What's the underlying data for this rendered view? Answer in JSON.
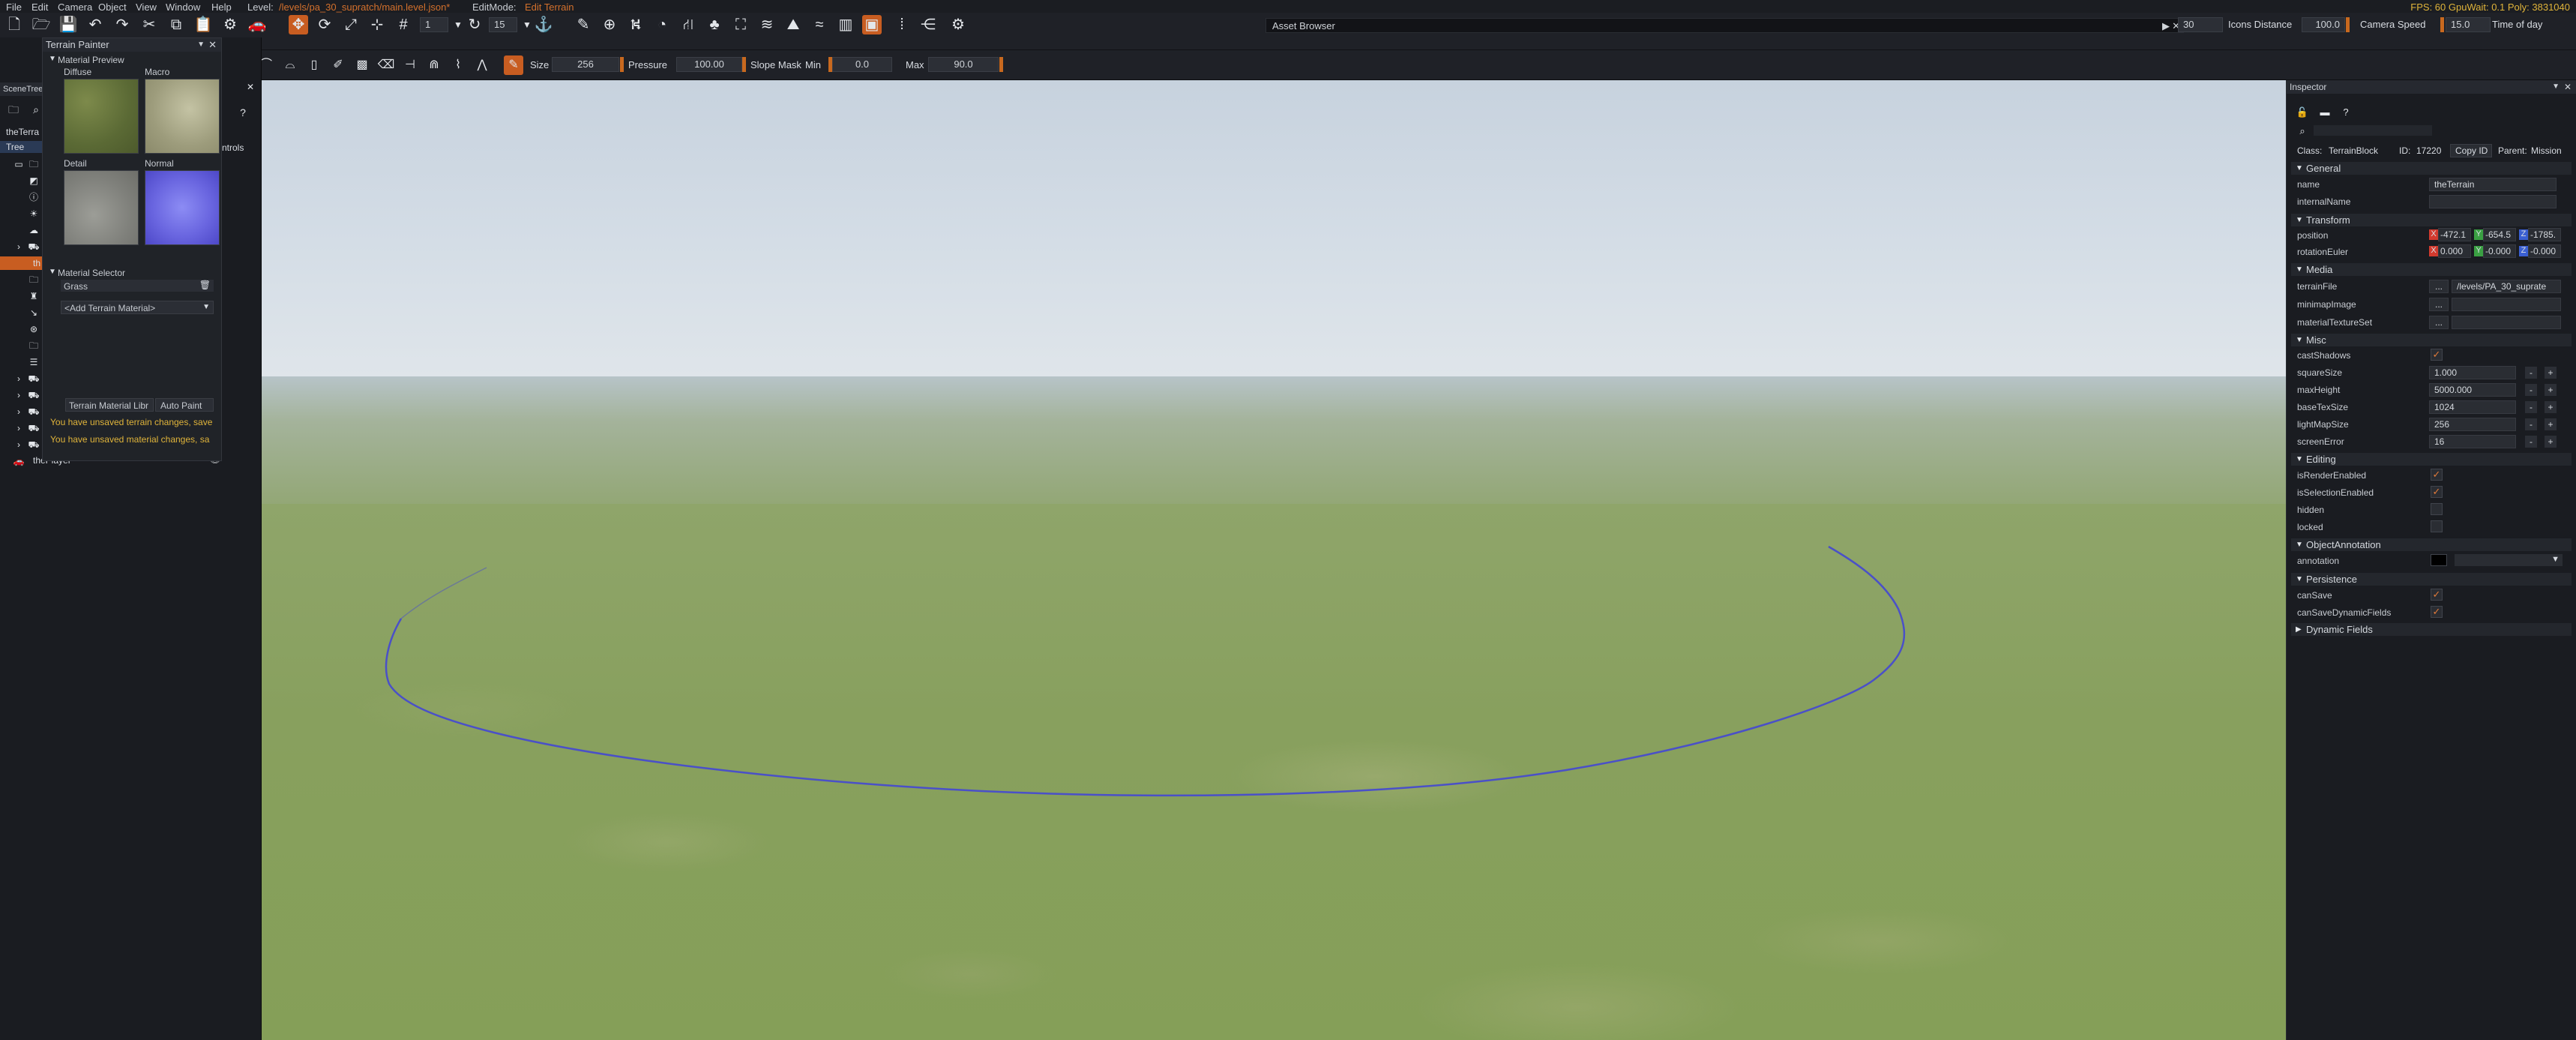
{
  "menu": {
    "items": [
      "File",
      "Edit",
      "Camera",
      "Object",
      "View",
      "Window",
      "Help"
    ],
    "level_label": "Level:",
    "level_path": "/levels/pa_30_supratch/main.level.json*",
    "editmode_label": "EditMode:",
    "editmode_value": "Edit Terrain",
    "stats": "FPS: 60  GpuWait: 0.1  Poly: 3831040"
  },
  "toolbar": {
    "snap_value": "1",
    "rotate_value": "15",
    "asset_browser": "Asset Browser",
    "icons_distance_value": "30",
    "icons_distance_label": "Icons Distance",
    "camera_speed_value": "100.0",
    "camera_speed_label": "Camera Speed",
    "time_value": "15.0",
    "time_label": "Time of day"
  },
  "brush": {
    "size_label": "Size",
    "size_value": "256",
    "pressure_label": "Pressure",
    "pressure_value": "100.00",
    "slope_label": "Slope Mask",
    "min_label": "Min",
    "min_value": "0.0",
    "max_label": "Max",
    "max_value": "90.0"
  },
  "scene_tree": {
    "tab": "SceneTree",
    "root_label": "theTerra",
    "tree_tab": "Tree",
    "controls_label": "ntrols",
    "player_label": "thePlayer",
    "selected_label": "th"
  },
  "terrain_painter": {
    "title": "Terrain Painter",
    "material_preview": "Material Preview",
    "diffuse": "Diffuse",
    "macro": "Macro",
    "detail": "Detail",
    "normal": "Normal",
    "material_selector": "Material Selector",
    "selected_material": "Grass",
    "add_material": "<Add Terrain Material>",
    "library_button": "Terrain Material Libr",
    "auto_paint_button": "Auto Paint",
    "warning_terrain": "You have unsaved terrain changes, save",
    "warning_material": "You have unsaved material changes, sa"
  },
  "inspector": {
    "title": "Inspector",
    "class_label": "Class:",
    "class_value": "TerrainBlock",
    "id_label": "ID:",
    "id_value": "17220",
    "copy_id": "Copy ID",
    "parent_label": "Parent:",
    "parent_value": "Mission",
    "sections": {
      "general": "General",
      "transform": "Transform",
      "media": "Media",
      "misc": "Misc",
      "editing": "Editing",
      "annotation": "ObjectAnnotation",
      "persistence": "Persistence",
      "dynamic": "Dynamic Fields"
    },
    "fields": {
      "name_label": "name",
      "name_value": "theTerrain",
      "internal_label": "internalName",
      "position_label": "position",
      "pos_x": "-472.1",
      "pos_y": "-654.5",
      "pos_z": "-1785.",
      "rotation_label": "rotationEuler",
      "rot_x": "0.000",
      "rot_y": "-0.000",
      "rot_z": "-0.000",
      "terrain_file_label": "terrainFile",
      "terrain_file_value": "/levels/PA_30_suprate",
      "minimap_label": "minimapImage",
      "material_set_label": "materialTextureSet",
      "cast_shadows_label": "castShadows",
      "square_size_label": "squareSize",
      "square_size_value": "1.000",
      "max_height_label": "maxHeight",
      "max_height_value": "5000.000",
      "base_tex_label": "baseTexSize",
      "base_tex_value": "1024",
      "lightmap_label": "lightMapSize",
      "lightmap_value": "256",
      "screen_error_label": "screenError",
      "screen_error_value": "16",
      "render_enabled_label": "isRenderEnabled",
      "selection_enabled_label": "isSelectionEnabled",
      "hidden_label": "hidden",
      "locked_label": "locked",
      "annotation_label": "annotation",
      "can_save_label": "canSave",
      "can_save_dyn_label": "canSaveDynamicFields",
      "browse": "...",
      "minus": "-",
      "plus": "+",
      "x": "X",
      "y": "Y",
      "z": "Z"
    }
  },
  "colors": {
    "accent": "#c85d21",
    "warning": "#e0b43a",
    "brush_ring": "#4a50c8",
    "axis_x": "#d23a2e",
    "axis_y": "#3aa043",
    "axis_z": "#3a5fd2"
  }
}
